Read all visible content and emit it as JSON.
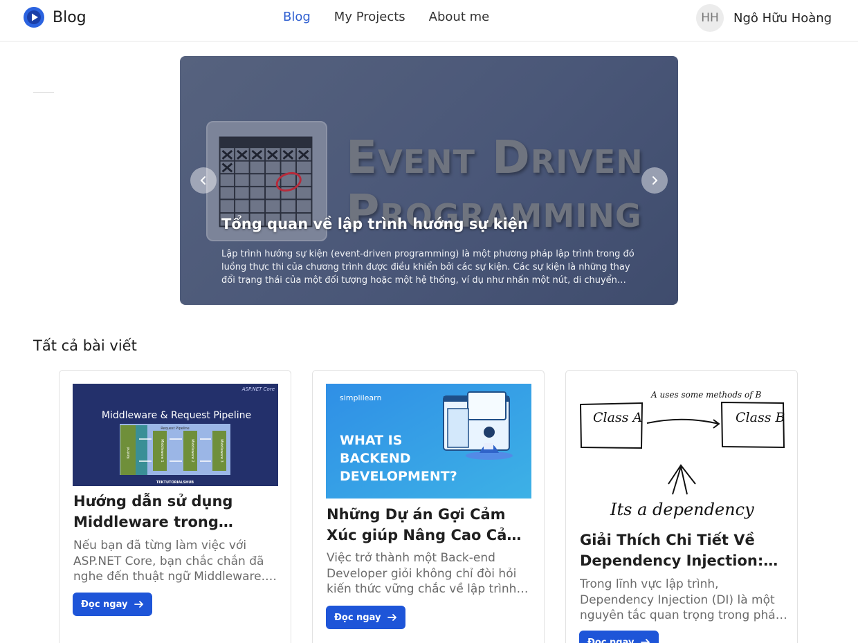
{
  "header": {
    "logo_text": "Blog",
    "nav": [
      {
        "label": "Blog",
        "active": true
      },
      {
        "label": "My Projects",
        "active": false
      },
      {
        "label": "About me",
        "active": false
      }
    ],
    "avatar_initials": "HH",
    "user_name": "Ngô Hữu Hoàng"
  },
  "hero": {
    "art_line1": "Event Driven",
    "art_line2": "Programming",
    "heading": "Tổng quan về lập trình hướng sự kiện",
    "description": "Lập trình hướng sự kiện (event-driven programming) là một phương pháp lập trình trong đó luồng thực thi của chương trình được điều khiển bởi các sự kiện. Các sự kiện là những thay đổi trạng thái của một đối tượng hoặc một hệ thống, ví dụ như nhấn một nút, di chuyển chuột, nhận một thông báo, hoặc",
    "prev_icon": "chevron-left-icon",
    "next_icon": "chevron-right-icon"
  },
  "section_title": "Tất cả bài viết",
  "cards": [
    {
      "image": {
        "corner": "ASP.NET Core",
        "title": "Middleware & Request Pipeline",
        "pipeline_label": "Request Pipeline",
        "boxes": [
          "Kestrel",
          "Middleware 1",
          "Middleware 2",
          "Middleware 3"
        ],
        "footer": "TEKTUTORIALSHUB"
      },
      "title": "Hướng dẫn sử dụng Middleware trong ASP.NET Core",
      "description": "Nếu bạn đã từng làm việc với ASP.NET Core, bạn chắc chắn đã nghe đến thuật ngữ Middleware. Middleware là",
      "button": "Đọc ngay"
    },
    {
      "image": {
        "brand": "simplilearn",
        "line1": "WHAT IS",
        "line2": "BACKEND",
        "line3": "DEVELOPMENT?"
      },
      "title": "Những Dự án Gợi Cảm Xúc giúp Nâng Cao Cảm Giác Trở thành Back-end Developer",
      "description": "Việc trở thành một Back-end Developer giỏi không chỉ đòi hỏi kiến thức vững chắc về lập trình mà còn",
      "button": "Đọc ngay"
    },
    {
      "image": {
        "box_a": "Class A",
        "box_b": "Class B",
        "relation": "A uses some methods of B",
        "caption": "Its a dependency"
      },
      "title": "Giải Thích Chi Tiết Về Dependency Injection: Tăng Tính Linh Hoạt",
      "description": "Trong lĩnh vực lập trình, Dependency Injection (DI) là một nguyên tắc quan trọng trong phát triển phần mềm",
      "button": "Đọc ngay"
    }
  ],
  "colors": {
    "accent": "#1e55d8",
    "nav_active": "#2f5fd0"
  }
}
